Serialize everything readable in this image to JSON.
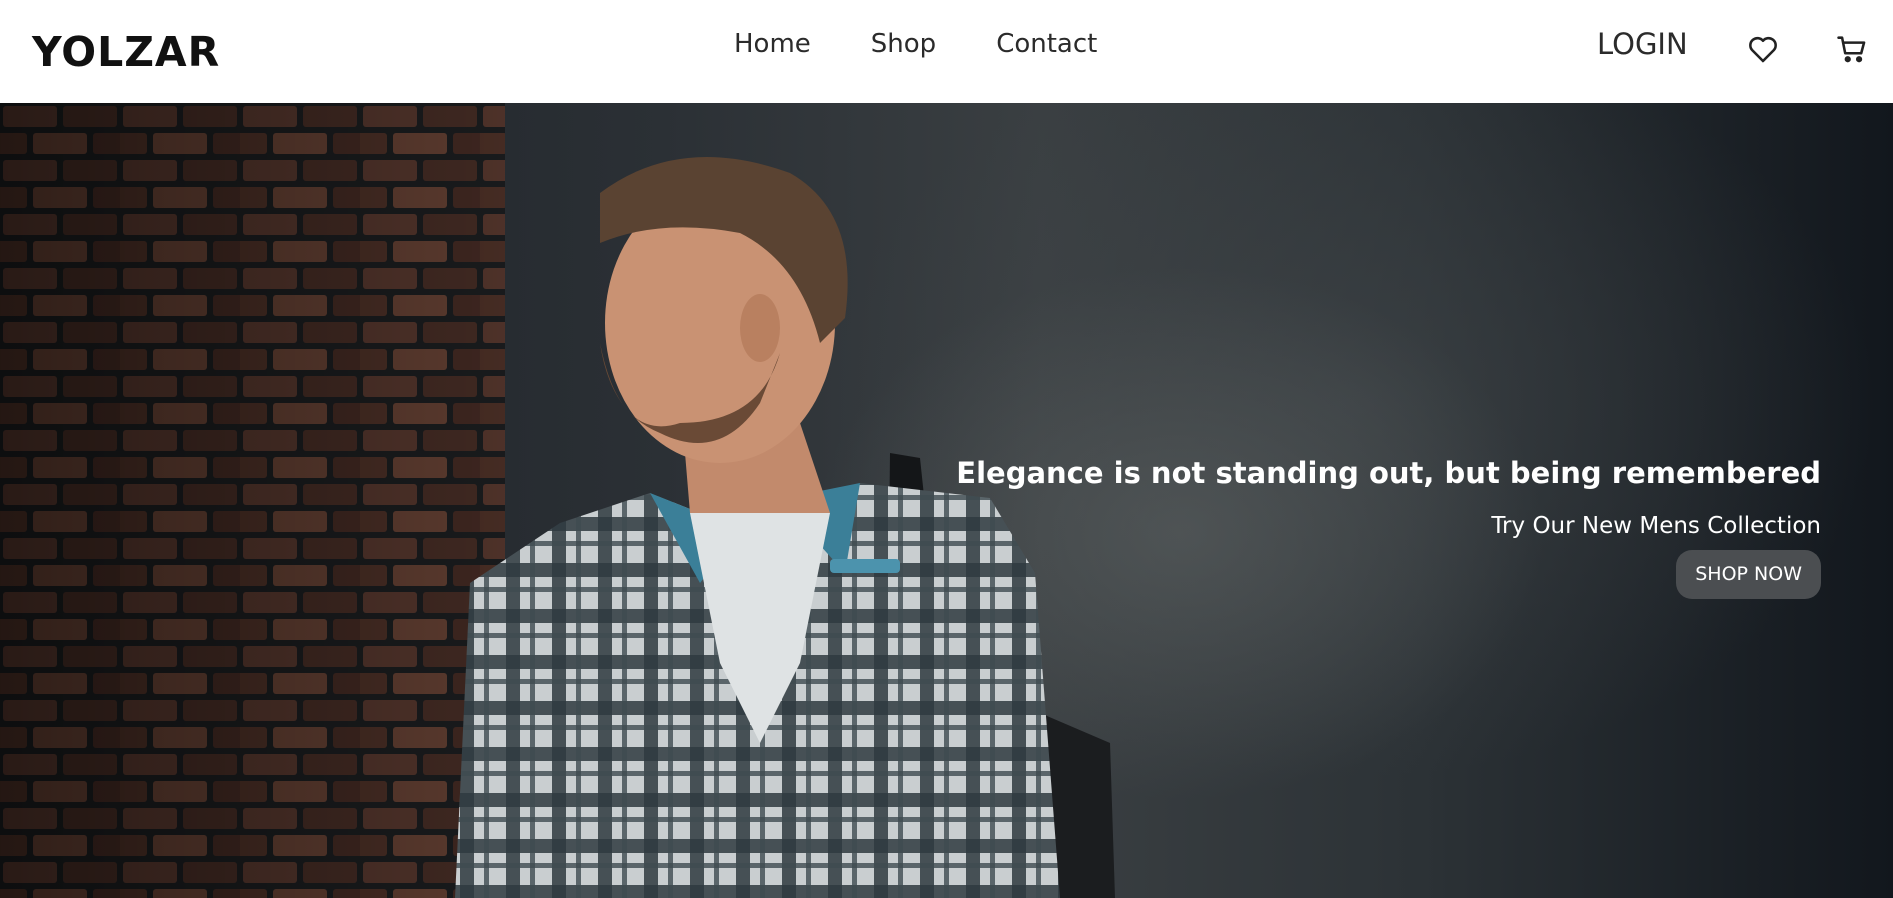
{
  "header": {
    "logo": "YOLZAR",
    "nav": [
      {
        "label": "Home"
      },
      {
        "label": "Shop"
      },
      {
        "label": "Contact"
      }
    ],
    "login_label": "LOGIN",
    "icons": {
      "wishlist": "heart-icon",
      "cart": "cart-icon"
    }
  },
  "hero": {
    "image": "man-in-plaid-shirt-photo",
    "headline": "Elegance is not standing out, but being remembered",
    "subhead": "Try Our New Mens Collection",
    "cta_label": "SHOP NOW"
  },
  "colors": {
    "header_bg": "#ffffff",
    "hero_text": "#ffffff",
    "cta_bg": "#4b4e51"
  }
}
